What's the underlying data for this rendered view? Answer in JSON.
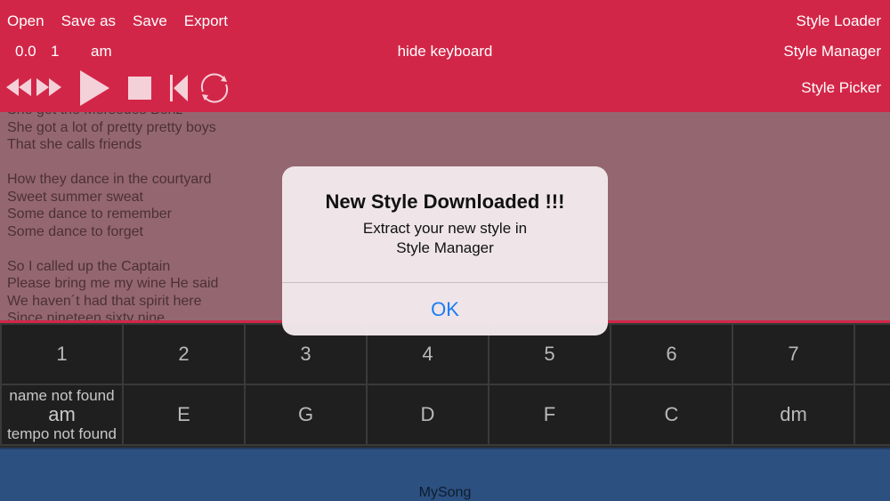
{
  "menu": [
    "Open",
    "Save as",
    "Save",
    "Export"
  ],
  "right_links": {
    "style_loader": "Style Loader",
    "style_manager": "Style Manager",
    "style_picker": "Style Picker"
  },
  "status": {
    "position": "0.0",
    "bar": "1",
    "chord": "am"
  },
  "hide_keyboard": "hide keyboard",
  "lyrics": [
    "She got the Mersedes Benz",
    "She got a lot of pretty pretty boys",
    "That she calls friends",
    "",
    "How they dance in the courtyard",
    "Sweet summer sweat",
    "Some dance to remember",
    "Some dance to forget",
    "",
    "So I called up the Captain",
    "Please bring me my wine He said",
    "We haven´t had that spirit here",
    "Since nineteen sixty nine"
  ],
  "grid": {
    "numbers": [
      "1",
      "2",
      "3",
      "4",
      "5",
      "6",
      "7"
    ],
    "first_cell": {
      "name": "name not found",
      "chord": "am",
      "tempo": "tempo not found"
    },
    "chords": [
      "E",
      "G",
      "D",
      "F",
      "C",
      "dm"
    ]
  },
  "song_name": "MySong",
  "alert": {
    "title": "New Style Downloaded !!!",
    "message_line1": "Extract your new style in",
    "message_line2": "Style Manager",
    "ok": "OK"
  },
  "colors": {
    "toolbar": "#d22648",
    "lyrics_bg": "#946770",
    "grid_cell": "#1f1f1f",
    "bottom_bar": "#2c5080",
    "ok_button": "#1a7cf5"
  },
  "icons": [
    "rewind-icon",
    "fast-forward-icon",
    "play-icon",
    "stop-icon",
    "skip-to-start-icon",
    "loop-icon"
  ]
}
